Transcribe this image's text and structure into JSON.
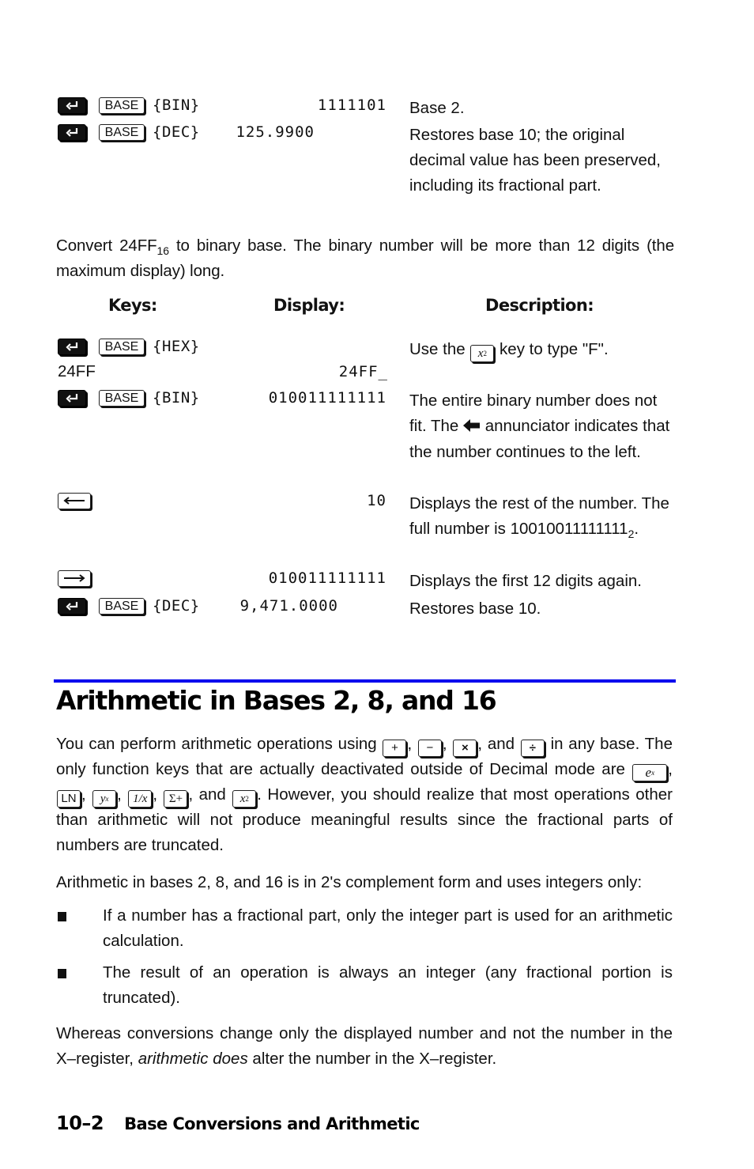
{
  "table1": {
    "rows": [
      {
        "shift": true,
        "key": "BASE",
        "softkey": "{BIN}",
        "display": "1111101",
        "description": "Base 2."
      },
      {
        "shift": true,
        "key": "BASE",
        "softkey": "{DEC}",
        "display": "125.9900",
        "description": "Restores base 10; the original decimal value has been preserved, including its fractional part."
      }
    ]
  },
  "intro": {
    "text_before": "Convert 24FF",
    "subscript": "16",
    "text_after": " to binary base. The binary number will be more than 12 digits (the maximum display) long."
  },
  "table2": {
    "headers": {
      "keys": "Keys:",
      "display": "Display:",
      "description": "Description:"
    },
    "rows": [
      {
        "shift": true,
        "key": "BASE",
        "softkey": "{HEX}",
        "display": "",
        "description_before": "Use the ",
        "description_key": "x²",
        "description_after": " key to type \"F\"."
      },
      {
        "typed": "24FF",
        "display": "24FF_",
        "description": ""
      },
      {
        "shift": true,
        "key": "BASE",
        "softkey": "{BIN}",
        "display": "010011111111",
        "description_before": "The entire binary number does not fit. The ",
        "description_icon": "left-arrow-annunciator",
        "description_after": " annunciator indicates that the number continues to the left."
      },
      {
        "key": "←",
        "key_icon": "left-arrow",
        "display": "10",
        "description_before": "Displays the rest of the number. The full number is 10010011111111",
        "description_sub": "2",
        "description_after": "."
      },
      {
        "key": "→",
        "key_icon": "right-arrow",
        "display": "010011111111",
        "description": "Displays the first 12 digits again."
      },
      {
        "shift": true,
        "key": "BASE",
        "softkey": "{DEC}",
        "display": "9,471.0000",
        "description": "Restores base 10."
      }
    ]
  },
  "section": {
    "title": "Arithmetic in Bases 2, 8, and 16",
    "rule_color": "#0000ee",
    "para1": {
      "t1": "You can perform arithmetic operations using ",
      "keys_ops": [
        "+",
        "−",
        "×",
        "÷"
      ],
      "t2": " in any base. The only function keys that are actually deactivated outside of Decimal mode are ",
      "keys_fn": [
        "eˣ",
        "LN",
        "yˣ",
        "1/x",
        "Σ+",
        "x²"
      ],
      "t3": ". However, you should realize that most operations other than arithmetic will not produce meaningful results since the fractional parts of numbers are truncated."
    },
    "para2": "Arithmetic in bases 2, 8, and 16 is in 2's complement form and uses integers only:",
    "bullets": [
      "If a number has a fractional part, only the integer part is used for an arithmetic calculation.",
      "The result of an operation is always an integer (any fractional portion is truncated)."
    ],
    "para3": {
      "t1": "Whereas conversions change only the displayed number and not the number in the X–register, ",
      "em": "arithmetic does",
      "t2": " alter the number in the X–register."
    }
  },
  "footer": {
    "page_number": "10–2",
    "chapter_title": "Base Conversions and Arithmetic"
  }
}
